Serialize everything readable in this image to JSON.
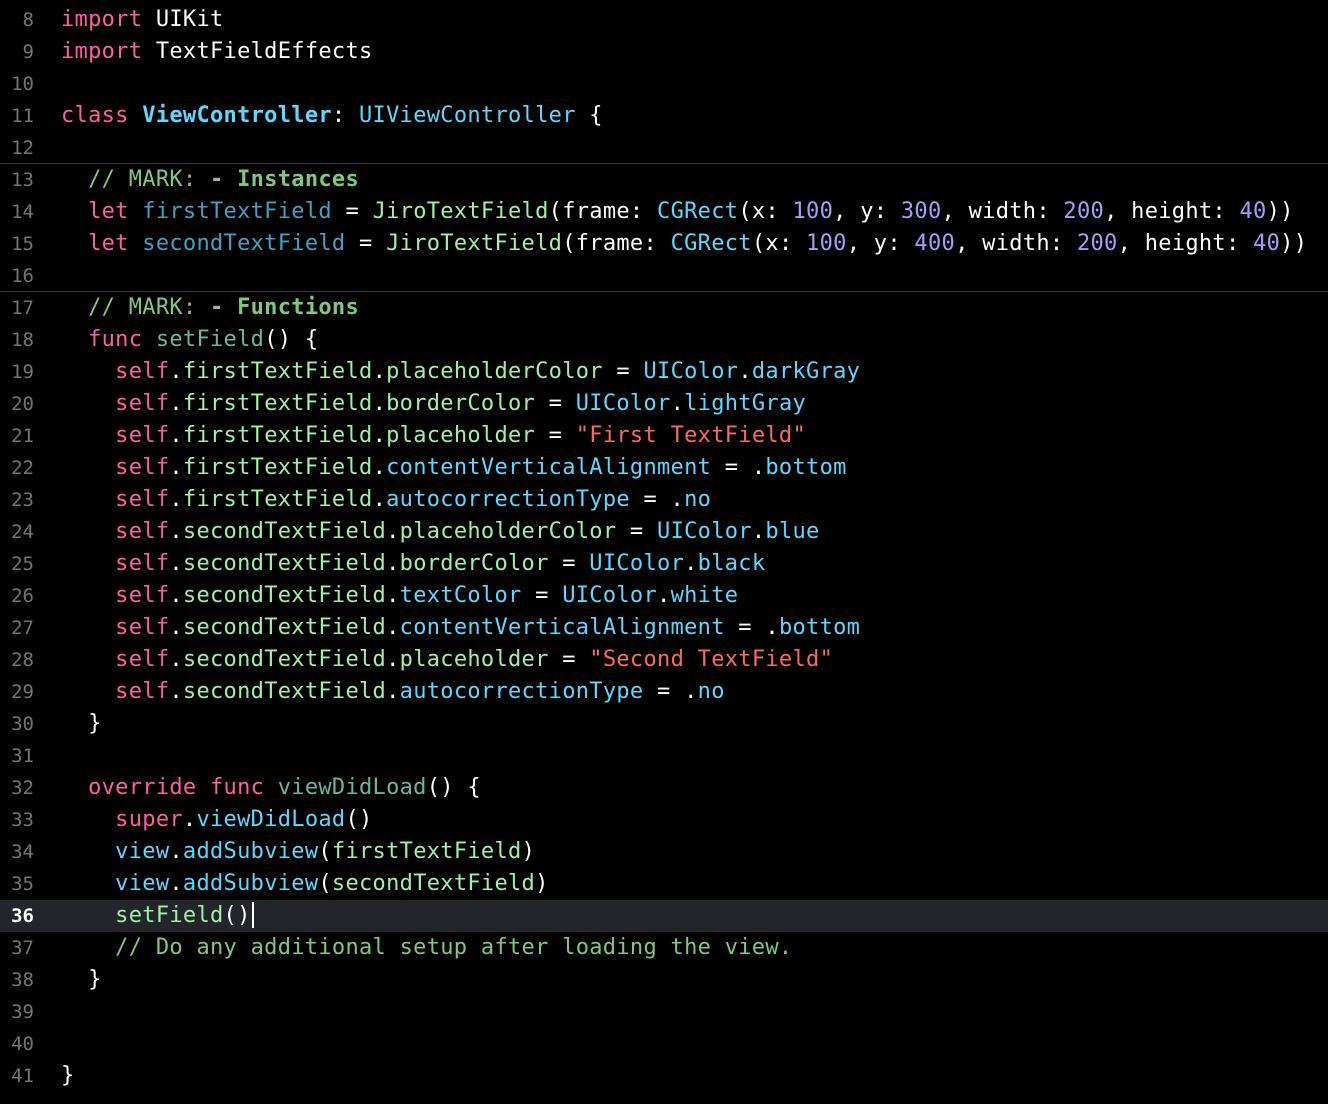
{
  "editor": {
    "current_line": "36",
    "lines": [
      {
        "num": "8",
        "tokens": [
          {
            "t": "import",
            "c": "#fc5fa3"
          },
          {
            "t": " UIKit",
            "c": "#ffffff"
          }
        ]
      },
      {
        "num": "9",
        "tokens": [
          {
            "t": "import",
            "c": "#fc5fa3"
          },
          {
            "t": " TextFieldEffects",
            "c": "#ffffff"
          }
        ]
      },
      {
        "num": "10",
        "tokens": []
      },
      {
        "num": "11",
        "tokens": [
          {
            "t": "class",
            "c": "#fc5fa3"
          },
          {
            "t": " ",
            "c": "#ffffff"
          },
          {
            "t": "ViewController",
            "c": "#5dd8ff",
            "b": true
          },
          {
            "t": ": ",
            "c": "#ffffff"
          },
          {
            "t": "UIViewController",
            "c": "#5dd8ff"
          },
          {
            "t": " {",
            "c": "#ffffff"
          }
        ]
      },
      {
        "num": "12",
        "tokens": []
      },
      {
        "num": "13",
        "sep": true,
        "tokens": [
          {
            "t": "  // MARK: ",
            "c": "#7ec97e"
          },
          {
            "t": "- Instances",
            "c": "#7ec97e",
            "b": true
          }
        ]
      },
      {
        "num": "14",
        "tokens": [
          {
            "t": "  let ",
            "c": "#fc5fa3"
          },
          {
            "t": "firstTextField",
            "c": "#41a1c0"
          },
          {
            "t": " = ",
            "c": "#ffffff"
          },
          {
            "t": "JiroTextField",
            "c": "#9ef1a5"
          },
          {
            "t": "(frame: ",
            "c": "#ffffff"
          },
          {
            "t": "CGRect",
            "c": "#5dd8ff"
          },
          {
            "t": "(x: ",
            "c": "#ffffff"
          },
          {
            "t": "100",
            "c": "#a79df9"
          },
          {
            "t": ", y: ",
            "c": "#ffffff"
          },
          {
            "t": "300",
            "c": "#a79df9"
          },
          {
            "t": ", width: ",
            "c": "#ffffff"
          },
          {
            "t": "200",
            "c": "#a79df9"
          },
          {
            "t": ", height: ",
            "c": "#ffffff"
          },
          {
            "t": "40",
            "c": "#a79df9"
          },
          {
            "t": "))",
            "c": "#ffffff"
          }
        ]
      },
      {
        "num": "15",
        "tokens": [
          {
            "t": "  let ",
            "c": "#fc5fa3"
          },
          {
            "t": "secondTextField",
            "c": "#41a1c0"
          },
          {
            "t": " = ",
            "c": "#ffffff"
          },
          {
            "t": "JiroTextField",
            "c": "#9ef1a5"
          },
          {
            "t": "(frame: ",
            "c": "#ffffff"
          },
          {
            "t": "CGRect",
            "c": "#5dd8ff"
          },
          {
            "t": "(x: ",
            "c": "#ffffff"
          },
          {
            "t": "100",
            "c": "#a79df9"
          },
          {
            "t": ", y: ",
            "c": "#ffffff"
          },
          {
            "t": "400",
            "c": "#a79df9"
          },
          {
            "t": ", width: ",
            "c": "#ffffff"
          },
          {
            "t": "200",
            "c": "#a79df9"
          },
          {
            "t": ", height: ",
            "c": "#ffffff"
          },
          {
            "t": "40",
            "c": "#a79df9"
          },
          {
            "t": "))",
            "c": "#ffffff"
          }
        ]
      },
      {
        "num": "16",
        "tokens": []
      },
      {
        "num": "17",
        "sep": true,
        "tokens": [
          {
            "t": "  // MARK: ",
            "c": "#7ec97e"
          },
          {
            "t": "- Functions",
            "c": "#7ec97e",
            "b": true
          }
        ]
      },
      {
        "num": "18",
        "tokens": [
          {
            "t": "  func ",
            "c": "#fc5fa3"
          },
          {
            "t": "setField",
            "c": "#67b7a4"
          },
          {
            "t": "() {",
            "c": "#ffffff"
          }
        ]
      },
      {
        "num": "19",
        "tokens": [
          {
            "t": "    self",
            "c": "#fc5fa3"
          },
          {
            "t": ".",
            "c": "#ffffff"
          },
          {
            "t": "firstTextField",
            "c": "#9ef1a5"
          },
          {
            "t": ".",
            "c": "#ffffff"
          },
          {
            "t": "placeholderColor",
            "c": "#9ef1a5"
          },
          {
            "t": " = ",
            "c": "#ffffff"
          },
          {
            "t": "UIColor",
            "c": "#5dd8ff"
          },
          {
            "t": ".",
            "c": "#ffffff"
          },
          {
            "t": "darkGray",
            "c": "#5dd8ff"
          }
        ]
      },
      {
        "num": "20",
        "tokens": [
          {
            "t": "    self",
            "c": "#fc5fa3"
          },
          {
            "t": ".",
            "c": "#ffffff"
          },
          {
            "t": "firstTextField",
            "c": "#9ef1a5"
          },
          {
            "t": ".",
            "c": "#ffffff"
          },
          {
            "t": "borderColor",
            "c": "#9ef1a5"
          },
          {
            "t": " = ",
            "c": "#ffffff"
          },
          {
            "t": "UIColor",
            "c": "#5dd8ff"
          },
          {
            "t": ".",
            "c": "#ffffff"
          },
          {
            "t": "lightGray",
            "c": "#5dd8ff"
          }
        ]
      },
      {
        "num": "21",
        "tokens": [
          {
            "t": "    self",
            "c": "#fc5fa3"
          },
          {
            "t": ".",
            "c": "#ffffff"
          },
          {
            "t": "firstTextField",
            "c": "#9ef1a5"
          },
          {
            "t": ".",
            "c": "#ffffff"
          },
          {
            "t": "placeholder",
            "c": "#9ef1a5"
          },
          {
            "t": " = ",
            "c": "#ffffff"
          },
          {
            "t": "\"First TextField\"",
            "c": "#fc6a5d"
          }
        ]
      },
      {
        "num": "22",
        "tokens": [
          {
            "t": "    self",
            "c": "#fc5fa3"
          },
          {
            "t": ".",
            "c": "#ffffff"
          },
          {
            "t": "firstTextField",
            "c": "#9ef1a5"
          },
          {
            "t": ".",
            "c": "#ffffff"
          },
          {
            "t": "contentVerticalAlignment",
            "c": "#5dd8ff"
          },
          {
            "t": " = .",
            "c": "#ffffff"
          },
          {
            "t": "bottom",
            "c": "#5dd8ff"
          }
        ]
      },
      {
        "num": "23",
        "tokens": [
          {
            "t": "    self",
            "c": "#fc5fa3"
          },
          {
            "t": ".",
            "c": "#ffffff"
          },
          {
            "t": "firstTextField",
            "c": "#9ef1a5"
          },
          {
            "t": ".",
            "c": "#ffffff"
          },
          {
            "t": "autocorrectionType",
            "c": "#5dd8ff"
          },
          {
            "t": " = .",
            "c": "#ffffff"
          },
          {
            "t": "no",
            "c": "#5dd8ff"
          }
        ]
      },
      {
        "num": "24",
        "tokens": [
          {
            "t": "    self",
            "c": "#fc5fa3"
          },
          {
            "t": ".",
            "c": "#ffffff"
          },
          {
            "t": "secondTextField",
            "c": "#9ef1a5"
          },
          {
            "t": ".",
            "c": "#ffffff"
          },
          {
            "t": "placeholderColor",
            "c": "#9ef1a5"
          },
          {
            "t": " = ",
            "c": "#ffffff"
          },
          {
            "t": "UIColor",
            "c": "#5dd8ff"
          },
          {
            "t": ".",
            "c": "#ffffff"
          },
          {
            "t": "blue",
            "c": "#5dd8ff"
          }
        ]
      },
      {
        "num": "25",
        "tokens": [
          {
            "t": "    self",
            "c": "#fc5fa3"
          },
          {
            "t": ".",
            "c": "#ffffff"
          },
          {
            "t": "secondTextField",
            "c": "#9ef1a5"
          },
          {
            "t": ".",
            "c": "#ffffff"
          },
          {
            "t": "borderColor",
            "c": "#9ef1a5"
          },
          {
            "t": " = ",
            "c": "#ffffff"
          },
          {
            "t": "UIColor",
            "c": "#5dd8ff"
          },
          {
            "t": ".",
            "c": "#ffffff"
          },
          {
            "t": "black",
            "c": "#5dd8ff"
          }
        ]
      },
      {
        "num": "26",
        "tokens": [
          {
            "t": "    self",
            "c": "#fc5fa3"
          },
          {
            "t": ".",
            "c": "#ffffff"
          },
          {
            "t": "secondTextField",
            "c": "#9ef1a5"
          },
          {
            "t": ".",
            "c": "#ffffff"
          },
          {
            "t": "textColor",
            "c": "#5dd8ff"
          },
          {
            "t": " = ",
            "c": "#ffffff"
          },
          {
            "t": "UIColor",
            "c": "#5dd8ff"
          },
          {
            "t": ".",
            "c": "#ffffff"
          },
          {
            "t": "white",
            "c": "#5dd8ff"
          }
        ]
      },
      {
        "num": "27",
        "tokens": [
          {
            "t": "    self",
            "c": "#fc5fa3"
          },
          {
            "t": ".",
            "c": "#ffffff"
          },
          {
            "t": "secondTextField",
            "c": "#9ef1a5"
          },
          {
            "t": ".",
            "c": "#ffffff"
          },
          {
            "t": "contentVerticalAlignment",
            "c": "#5dd8ff"
          },
          {
            "t": " = .",
            "c": "#ffffff"
          },
          {
            "t": "bottom",
            "c": "#5dd8ff"
          }
        ]
      },
      {
        "num": "28",
        "tokens": [
          {
            "t": "    self",
            "c": "#fc5fa3"
          },
          {
            "t": ".",
            "c": "#ffffff"
          },
          {
            "t": "secondTextField",
            "c": "#9ef1a5"
          },
          {
            "t": ".",
            "c": "#ffffff"
          },
          {
            "t": "placeholder",
            "c": "#9ef1a5"
          },
          {
            "t": " = ",
            "c": "#ffffff"
          },
          {
            "t": "\"Second TextField\"",
            "c": "#fc6a5d"
          }
        ]
      },
      {
        "num": "29",
        "tokens": [
          {
            "t": "    self",
            "c": "#fc5fa3"
          },
          {
            "t": ".",
            "c": "#ffffff"
          },
          {
            "t": "secondTextField",
            "c": "#9ef1a5"
          },
          {
            "t": ".",
            "c": "#ffffff"
          },
          {
            "t": "autocorrectionType",
            "c": "#5dd8ff"
          },
          {
            "t": " = .",
            "c": "#ffffff"
          },
          {
            "t": "no",
            "c": "#5dd8ff"
          }
        ]
      },
      {
        "num": "30",
        "tokens": [
          {
            "t": "  }",
            "c": "#ffffff"
          }
        ]
      },
      {
        "num": "31",
        "tokens": []
      },
      {
        "num": "32",
        "tokens": [
          {
            "t": "  override func ",
            "c": "#fc5fa3"
          },
          {
            "t": "viewDidLoad",
            "c": "#67b7a4"
          },
          {
            "t": "() {",
            "c": "#ffffff"
          }
        ]
      },
      {
        "num": "33",
        "tokens": [
          {
            "t": "    super",
            "c": "#fc5fa3"
          },
          {
            "t": ".",
            "c": "#ffffff"
          },
          {
            "t": "viewDidLoad",
            "c": "#5dd8ff"
          },
          {
            "t": "()",
            "c": "#ffffff"
          }
        ]
      },
      {
        "num": "34",
        "tokens": [
          {
            "t": "    view",
            "c": "#5dd8ff"
          },
          {
            "t": ".",
            "c": "#ffffff"
          },
          {
            "t": "addSubview",
            "c": "#5dd8ff"
          },
          {
            "t": "(",
            "c": "#ffffff"
          },
          {
            "t": "firstTextField",
            "c": "#9ef1a5"
          },
          {
            "t": ")",
            "c": "#ffffff"
          }
        ]
      },
      {
        "num": "35",
        "tokens": [
          {
            "t": "    view",
            "c": "#5dd8ff"
          },
          {
            "t": ".",
            "c": "#ffffff"
          },
          {
            "t": "addSubview",
            "c": "#5dd8ff"
          },
          {
            "t": "(",
            "c": "#ffffff"
          },
          {
            "t": "secondTextField",
            "c": "#9ef1a5"
          },
          {
            "t": ")",
            "c": "#ffffff"
          }
        ]
      },
      {
        "num": "36",
        "current": true,
        "tokens": [
          {
            "t": "    setField",
            "c": "#9ef1a5"
          },
          {
            "t": "()",
            "c": "#ffffff"
          }
        ]
      },
      {
        "num": "37",
        "tokens": [
          {
            "t": "    // Do any additional setup after loading the view.",
            "c": "#7ec97e"
          }
        ]
      },
      {
        "num": "38",
        "tokens": [
          {
            "t": "  }",
            "c": "#ffffff"
          }
        ]
      },
      {
        "num": "39",
        "tokens": []
      },
      {
        "num": "40",
        "tokens": []
      },
      {
        "num": "41",
        "tokens": [
          {
            "t": "}",
            "c": "#ffffff"
          }
        ]
      }
    ]
  },
  "colors": {
    "background": "#000000",
    "current_line_bg": "#23252b",
    "gutter_text": "#747478"
  }
}
